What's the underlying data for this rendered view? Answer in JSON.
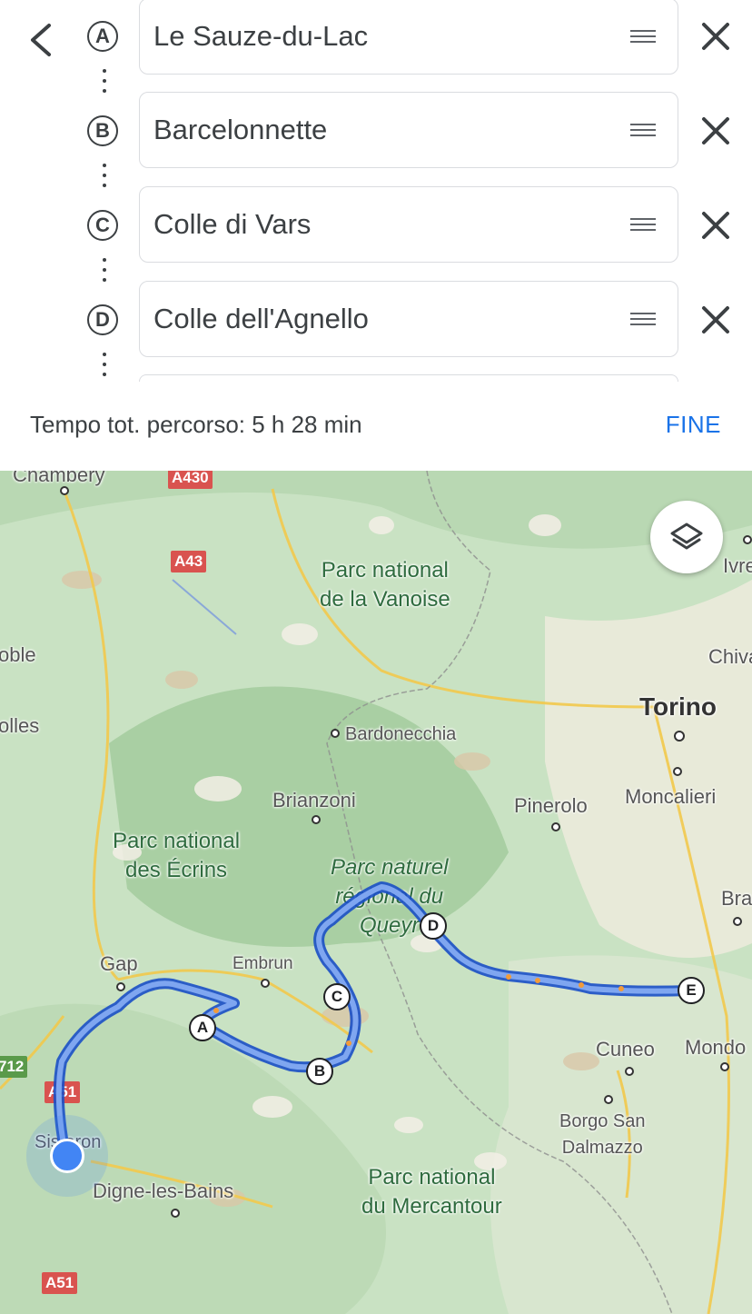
{
  "stops": [
    {
      "letter": "A",
      "name": "Le Sauze-du-Lac"
    },
    {
      "letter": "B",
      "name": "Barcelonnette"
    },
    {
      "letter": "C",
      "name": "Colle di Vars"
    },
    {
      "letter": "D",
      "name": "Colle dell'Agnello"
    }
  ],
  "summary": {
    "total_time": "Tempo tot. percorso: 5 h 28 min",
    "done_label": "FINE"
  },
  "map": {
    "parks": {
      "vanoise": "Parc national\nde la Vanoise",
      "ecrins": "Parc national\ndes Écrins",
      "queyras": "Parc naturel\nrégional du\nQueyr",
      "mercantour": "Parc national\ndu Mercantour"
    },
    "cities": {
      "chambery": "Chambéry",
      "grenoble": "oble",
      "olles": "olles",
      "bardonecchia": "Bardonecchia",
      "torino": "Torino",
      "brianzoni": "Brianzoni",
      "pinerolo": "Pinerolo",
      "moncalieri": "Moncalieri",
      "chiva": "Chiva",
      "ivre": "Ivre",
      "bra": "Bra",
      "gap": "Gap",
      "embrun": "Embrun",
      "cuneo": "Cuneo",
      "mondo": "Mondo",
      "borgo": "Borgo San\nDalmazzo",
      "sisteron": "Sisteron",
      "digne": "Digne-les-Bains"
    },
    "roads": {
      "a430": "A430",
      "a43": "A43",
      "a51_top": "A51",
      "a51_bottom": "A51",
      "e712": "712"
    },
    "waypoints": [
      "A",
      "B",
      "C",
      "D",
      "E"
    ],
    "colors": {
      "route": "#4a78e8",
      "route_outline": "#1a4fc7",
      "my_location": "#4285f4"
    }
  }
}
